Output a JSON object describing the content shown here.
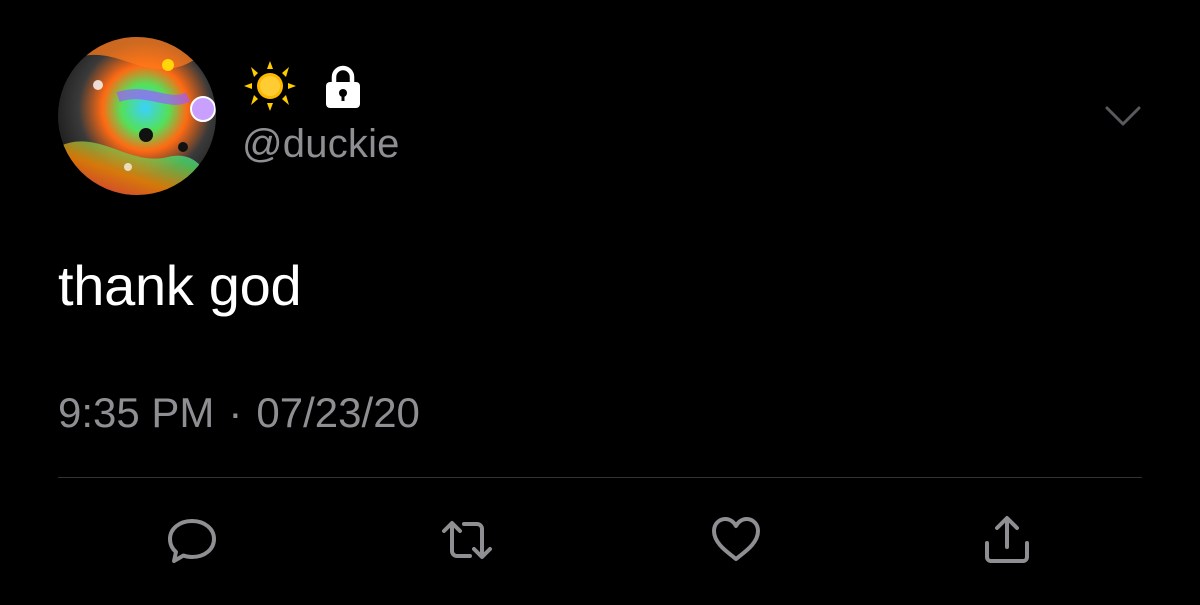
{
  "tweet": {
    "display_name_emojis": [
      "sun-icon",
      "lock-icon"
    ],
    "handle": "@duckie",
    "text": "thank god",
    "time": "9:35 PM",
    "separator": "·",
    "date": "07/23/20"
  },
  "actions": [
    "reply-icon",
    "retweet-icon",
    "like-icon",
    "share-icon"
  ],
  "colors": {
    "background": "#000000",
    "text_primary": "#ffffff",
    "text_secondary": "#8e8e93",
    "divider": "#2f3336",
    "icon": "#8e8e93",
    "sun": "#ffcc00"
  }
}
